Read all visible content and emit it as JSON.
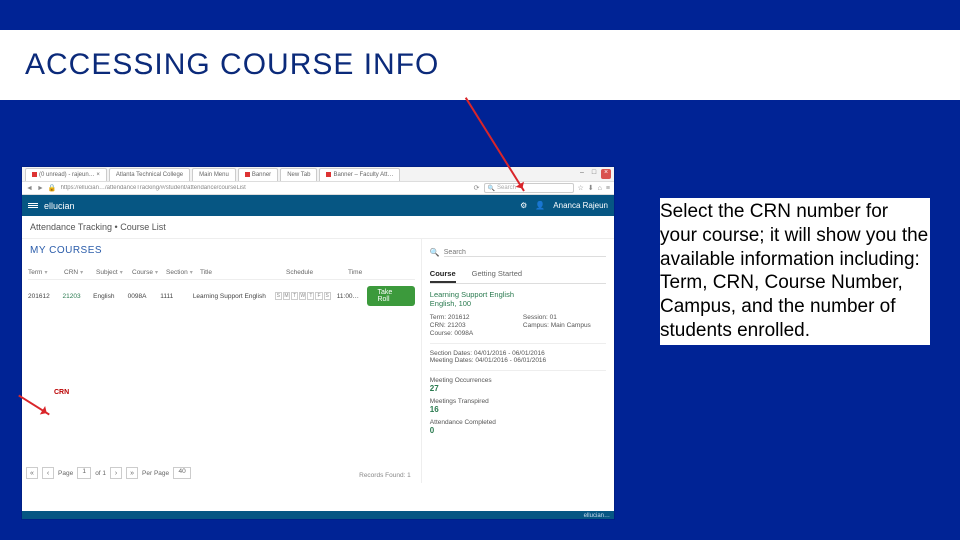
{
  "slide": {
    "title": "ACCESSING COURSE INFO",
    "explain": "Select the CRN number for your course; it will show you the available information including: Term, CRN, Course Number, Campus, and the number of students enrolled."
  },
  "browser": {
    "tabs": [
      "(0 unread) - rajeun… ×",
      "Atlanta Technical College",
      "Main Menu",
      "Banner",
      "New Tab",
      "Banner – Faculty Att…"
    ],
    "url": "https://ellucian…/attendanceTracking/#/student/attendance/courseList",
    "search_placeholder": "Search"
  },
  "app": {
    "brand": "ellucian",
    "user": "Ananca Rajeun",
    "breadcrumb": "Attendance Tracking • Course List",
    "my_courses": "MY COURSES",
    "search_placeholder": "Search"
  },
  "table": {
    "headers": [
      "Term",
      "CRN",
      "Subject",
      "Course",
      "Section",
      "Title",
      "Schedule",
      "Time"
    ],
    "row": {
      "term": "201612",
      "crn": "21203",
      "subject": "English",
      "course": "0098A",
      "section": "1111",
      "title": "Learning Support English",
      "days": [
        "S",
        "M",
        "T",
        "W",
        "T",
        "F",
        "S"
      ],
      "time": "11:00…"
    },
    "take_roll": "Take Roll",
    "crn_callout": "CRN"
  },
  "side": {
    "tab_course": "Course",
    "tab_started": "Getting Started",
    "course_title": "Learning Support English\nEnglish, 100",
    "kv": {
      "term": "Term: 201612",
      "session": "Session: 01",
      "crn": "CRN: 21203",
      "campus": "Campus: Main Campus",
      "courseno": "Course: 0098A"
    },
    "section_dates": "Section Dates: 04/01/2016 - 06/01/2016",
    "meeting_dates": "Meeting Dates: 04/01/2016 - 06/01/2016",
    "m1_label": "Meeting Occurrences",
    "m1_val": "27",
    "m2_label": "Meetings Transpired",
    "m2_val": "16",
    "m3_label": "Attendance Completed",
    "m3_val": "0"
  },
  "pager": {
    "page_label": "Page",
    "page_val": "1",
    "of": "of 1",
    "perpage_label": "Per Page",
    "perpage_val": "40",
    "records": "Records Found: 1"
  },
  "footer": "ellucian…"
}
